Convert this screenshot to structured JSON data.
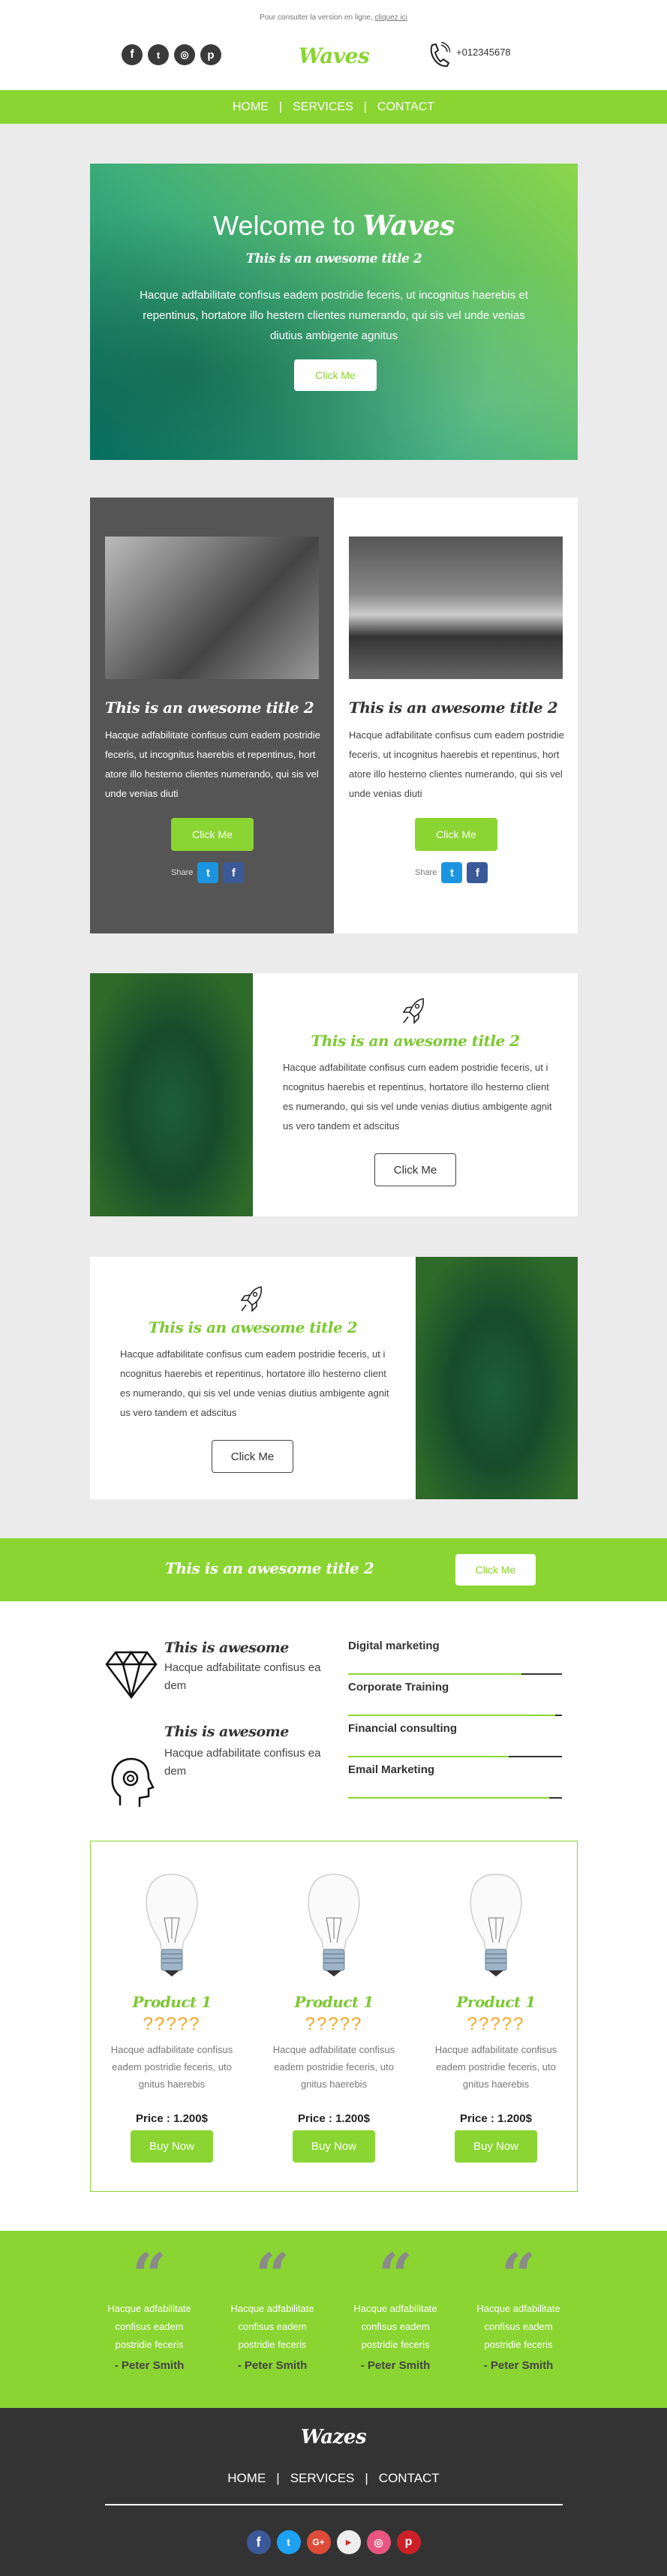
{
  "preheader": {
    "text": "Pour consulter la version en ligne,",
    "link": "cliquez ici"
  },
  "header": {
    "logo": "Waves",
    "phone": "+012345678",
    "social": [
      "facebook",
      "twitter",
      "instagram",
      "pinterest"
    ]
  },
  "nav": {
    "items": [
      "HOME",
      "SERVICES",
      "CONTACT"
    ],
    "separator": "|"
  },
  "hero": {
    "title_prefix": "Welcome to",
    "title_brand": "Waves",
    "subtitle": "This is an awesome title 2",
    "body": "Hacque adfabilitate confisus eadem postridie feceris, ut incognitus haerebis et repentinus, hortatore illo hestern clientes numerando, qui sis vel unde venias diutius ambigente agnitus",
    "button": "Click Me"
  },
  "cards": [
    {
      "title": "This is an awesome title 2",
      "body": "Hacque adfabilitate confisus cum eadem postridie feceris, ut incognitus haerebis et repentinus, hortatore illo hesterno clientes numerando, qui sis vel unde venias diuti",
      "button": "Click Me",
      "share_label": "Share"
    },
    {
      "title": "This is an awesome title 2",
      "body": "Hacque adfabilitate confisus cum eadem postridie feceris, ut incognitus haerebis et repentinus, hortatore illo hesterno clientes numerando, qui sis vel unde venias diuti",
      "button": "Click Me",
      "share_label": "Share"
    }
  ],
  "feature_rows": [
    {
      "icon": "rocket",
      "title": "This is an awesome title 2",
      "body": "Hacque adfabilitate confisus cum eadem postridie feceris, ut incognitus haerebis et repentinus, hortatore illo hesterno clientes numerando, qui sis vel unde venias diutius ambigente agnitus vero tandem et adscitus",
      "button": "Click Me"
    },
    {
      "icon": "rocket",
      "title": "This is an awesome title 2",
      "body": "Hacque adfabilitate confisus cum eadem postridie feceris, ut incognitus haerebis et repentinus, hortatore illo hesterno clientes numerando, qui sis vel unde venias diutius ambigente agnitus vero tandem et adscitus",
      "button": "Click Me"
    }
  ],
  "banner": {
    "title": "This is an awesome title 2",
    "button": "Click Me"
  },
  "features": [
    {
      "icon": "diamond",
      "title": "This is awesome",
      "body": "Hacque adfabilitate confisus eadem"
    },
    {
      "icon": "head-gear",
      "title": "This is awesome",
      "body": "Hacque adfabilitate confisus eadem"
    }
  ],
  "skills": [
    {
      "label": "Digital marketing",
      "progress": 0.81
    },
    {
      "label": "Corporate Training",
      "progress": 0.97
    },
    {
      "label": "Financial consulting",
      "progress": 0.75
    },
    {
      "label": "Email Marketing",
      "progress": 0.94
    }
  ],
  "products": [
    {
      "name": "Product 1",
      "rating": "?????",
      "body": "Hacque adfabilitate confisus eadem postridie feceris, uto gnitus haerebis",
      "price": "Price : 1.200$",
      "button": "Buy Now"
    },
    {
      "name": "Product 1",
      "rating": "?????",
      "body": "Hacque adfabilitate confisus eadem postridie feceris, uto gnitus haerebis",
      "price": "Price : 1.200$",
      "button": "Buy Now"
    },
    {
      "name": "Product 1",
      "rating": "?????",
      "body": "Hacque adfabilitate confisus eadem postridie feceris, uto gnitus haerebis",
      "price": "Price : 1.200$",
      "button": "Buy Now"
    }
  ],
  "testimonials": [
    {
      "body": "Hacque adfabilitate confisus eadem postridie feceris",
      "author": "- Peter Smith"
    },
    {
      "body": "Hacque adfabilitate confisus eadem postridie feceris",
      "author": "- Peter Smith"
    },
    {
      "body": "Hacque adfabilitate confisus eadem postridie feceris",
      "author": "- Peter Smith"
    },
    {
      "body": "Hacque adfabilitate confisus eadem postridie feceris",
      "author": "- Peter Smith"
    }
  ],
  "footer": {
    "logo": "Wazes",
    "nav": [
      "HOME",
      "SERVICES",
      "CONTACT"
    ],
    "separator": "|",
    "social": [
      "facebook",
      "twitter",
      "google-plus",
      "youtube",
      "instagram",
      "pinterest"
    ]
  },
  "colors": {
    "accent": "#8ad531",
    "dark_panel": "#555555",
    "footer": "#333333",
    "rating": "#f5a623",
    "quote": "#8a8a8a"
  }
}
